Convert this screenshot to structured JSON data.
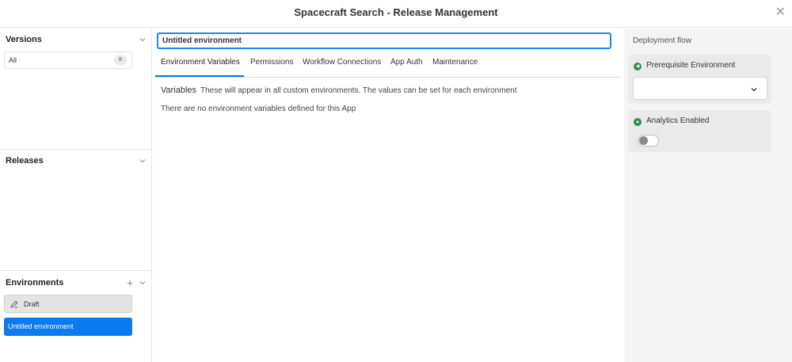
{
  "header": {
    "title": "Spacecraft Search - Release Management",
    "close_icon": "close-icon"
  },
  "sidebar": {
    "versions": {
      "title": "Versions",
      "filter_label": "All",
      "count": "8"
    },
    "releases": {
      "title": "Releases"
    },
    "environments": {
      "title": "Environments",
      "items": [
        {
          "label": "Draft",
          "icon": "pencil-icon"
        },
        {
          "label": "Untitled environment",
          "selected": true
        }
      ]
    }
  },
  "main": {
    "environment_name": "Untitled environment",
    "tabs": [
      {
        "label": "Environment Variables",
        "active": true
      },
      {
        "label": "Permissions"
      },
      {
        "label": "Workflow Connections"
      },
      {
        "label": "App Auth"
      },
      {
        "label": "Maintenance"
      }
    ],
    "variables_title": "Variables",
    "variables_description": "These will appear in all custom environments. The values can be set for each environment",
    "empty_message": "There are no environment variables defined for this App"
  },
  "deployment": {
    "title": "Deployment flow",
    "prerequisite_label": "Prerequisite Environment",
    "prerequisite_value": "",
    "analytics_label": "Analytics Enabled",
    "analytics_enabled": false
  },
  "colors": {
    "accent": "#0a7aee",
    "status_green": "#2b8f4e"
  }
}
